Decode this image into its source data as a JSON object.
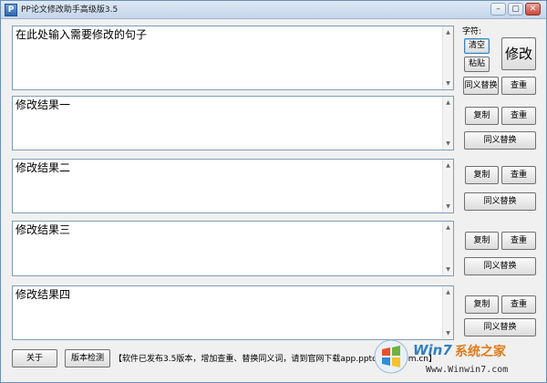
{
  "window": {
    "title": "PP论文修改助手高级版3.5",
    "icon_glyph": "P",
    "controls": {
      "minimize": "–",
      "maximize": "▢",
      "close": "✕"
    }
  },
  "input": {
    "text": "在此处输入需要修改的句子"
  },
  "side_panel": {
    "chars_label": "字符:",
    "clear_label": "清空",
    "paste_label": "粘贴",
    "modify_label": "修改",
    "synonym_label": "同义替换",
    "check_label": "查重"
  },
  "results": [
    {
      "text": "修改结果一",
      "copy_label": "复制",
      "check_label": "查重",
      "synonym_label": "同义替换"
    },
    {
      "text": "修改结果二",
      "copy_label": "复制",
      "check_label": "查重",
      "synonym_label": "同义替换"
    },
    {
      "text": "修改结果三",
      "copy_label": "复制",
      "check_label": "查重",
      "synonym_label": "同义替换"
    },
    {
      "text": "修改结果四",
      "copy_label": "复制",
      "check_label": "查重",
      "synonym_label": "同义替换"
    }
  ],
  "footer": {
    "about_label": "关于",
    "version_check_label": "版本检测",
    "status_text": "【软件已发布3.5版本，增加查重、替换同义词，请到官网下载app.pptcheck.com.cn】"
  },
  "watermark": {
    "brand": "Win7",
    "brand_cn": "系统之家",
    "url": "Www.Winwin7.com"
  },
  "colors": {
    "title_gradient_top": "#dfe9f5",
    "textbox_border": "#7f9db9",
    "window_bg": "#f0f0f0"
  }
}
